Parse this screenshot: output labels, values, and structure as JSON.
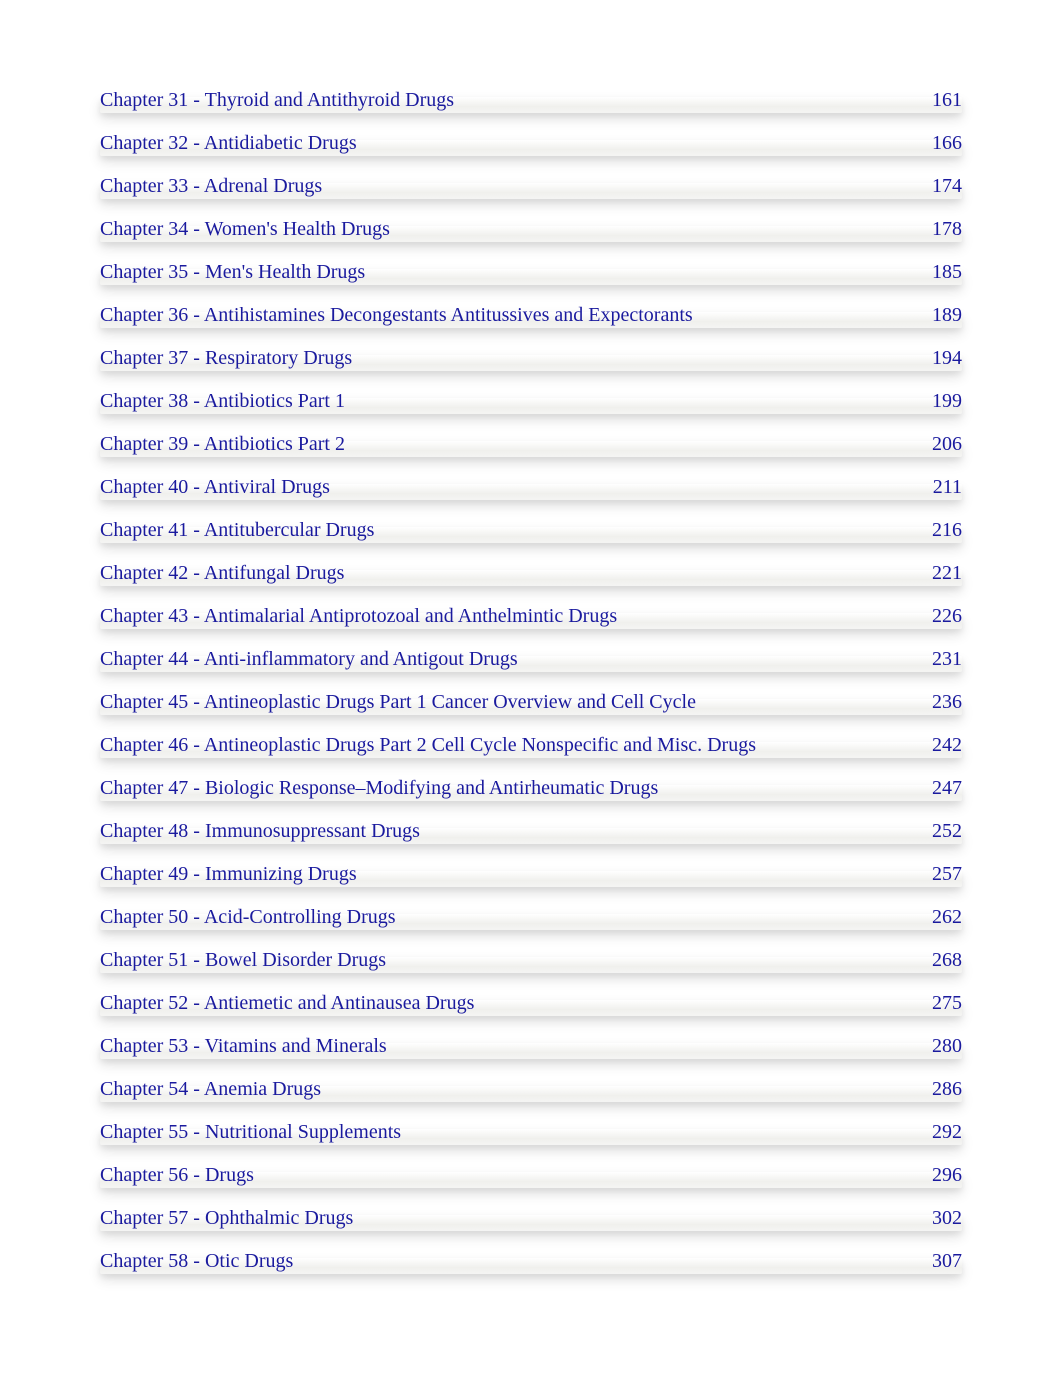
{
  "toc": [
    {
      "title": "Chapter   31  - Thyroid  and   Antithyroid   Drugs",
      "page": "161"
    },
    {
      "title": "Chapter   32  - Antidiabetic   Drugs",
      "page": "166"
    },
    {
      "title": "Chapter   33  - Adrenal   Drugs",
      "page": "174"
    },
    {
      "title": "Chapter   34  - Women's   Health   Drugs",
      "page": "178"
    },
    {
      "title": "Chapter   35  - Men's  Health   Drugs",
      "page": "185"
    },
    {
      "title": "Chapter 36 -  Antihistamines Decongestants Antitussives and Expectorants",
      "page": "189"
    },
    {
      "title": "Chapter   37  - Respiratory   Drugs",
      "page": "194"
    },
    {
      "title": "Chapter   38  - Antibiotics Part  1",
      "page": "199"
    },
    {
      "title": "Chapter   39  - Antibiotics Part  2",
      "page": "206"
    },
    {
      "title": "Chapter   40  - Antiviral Drugs",
      "page": "211"
    },
    {
      "title": "Chapter   41  - Antitubercular   Drugs",
      "page": "216"
    },
    {
      "title": "Chapter   42  - Antifungal  Drugs",
      "page": "221"
    },
    {
      "title": "Chapter   43  - Antimalarial   Antiprotozoal   and   Anthelmintic   Drugs",
      "page": "226"
    },
    {
      "title": "Chapter   44  - Anti-inflammatory   and   Antigout  Drugs",
      "page": "231"
    },
    {
      "title": "Chapter 45 - Antineoplastic Drugs Part 1 Cancer Overview and Cell Cycle",
      "page": "236"
    },
    {
      "title": "Chapter   46  - Antineoplastic   Drugs   Part  2  Cell  Cycle   Nonspecific   and  Misc.  Drugs",
      "page": "242",
      "wrap": true
    },
    {
      "title": "Chapter   47  - Biologic  Response–Modifying     and   Antirheumatic    Drugs",
      "page": "247"
    },
    {
      "title": "Chapter   48  - Immunosuppressant      Drugs",
      "page": "252"
    },
    {
      "title": "Chapter   49  - Immunizing   Drugs",
      "page": "257"
    },
    {
      "title": "Chapter   50  - Acid-Controlling   Drugs",
      "page": "262"
    },
    {
      "title": "Chapter   51  - Bowel  Disorder   Drugs",
      "page": "268"
    },
    {
      "title": "Chapter   52  - Antiemetic   and  Antinausea    Drugs",
      "page": "275"
    },
    {
      "title": "Chapter   53  - Vitamins   and  Minerals",
      "page": "280"
    },
    {
      "title": "Chapter   54  - Anemia   Drugs",
      "page": "286"
    },
    {
      "title": "Chapter   55  - Nutritional  Supplements",
      "page": "292"
    },
    {
      "title": "Chapter   56  - Drugs",
      "page": "296"
    },
    {
      "title": "Chapter   57  - Ophthalmic   Drugs",
      "page": "302"
    },
    {
      "title": "Chapter   58  - Otic Drugs",
      "page": "307"
    }
  ]
}
